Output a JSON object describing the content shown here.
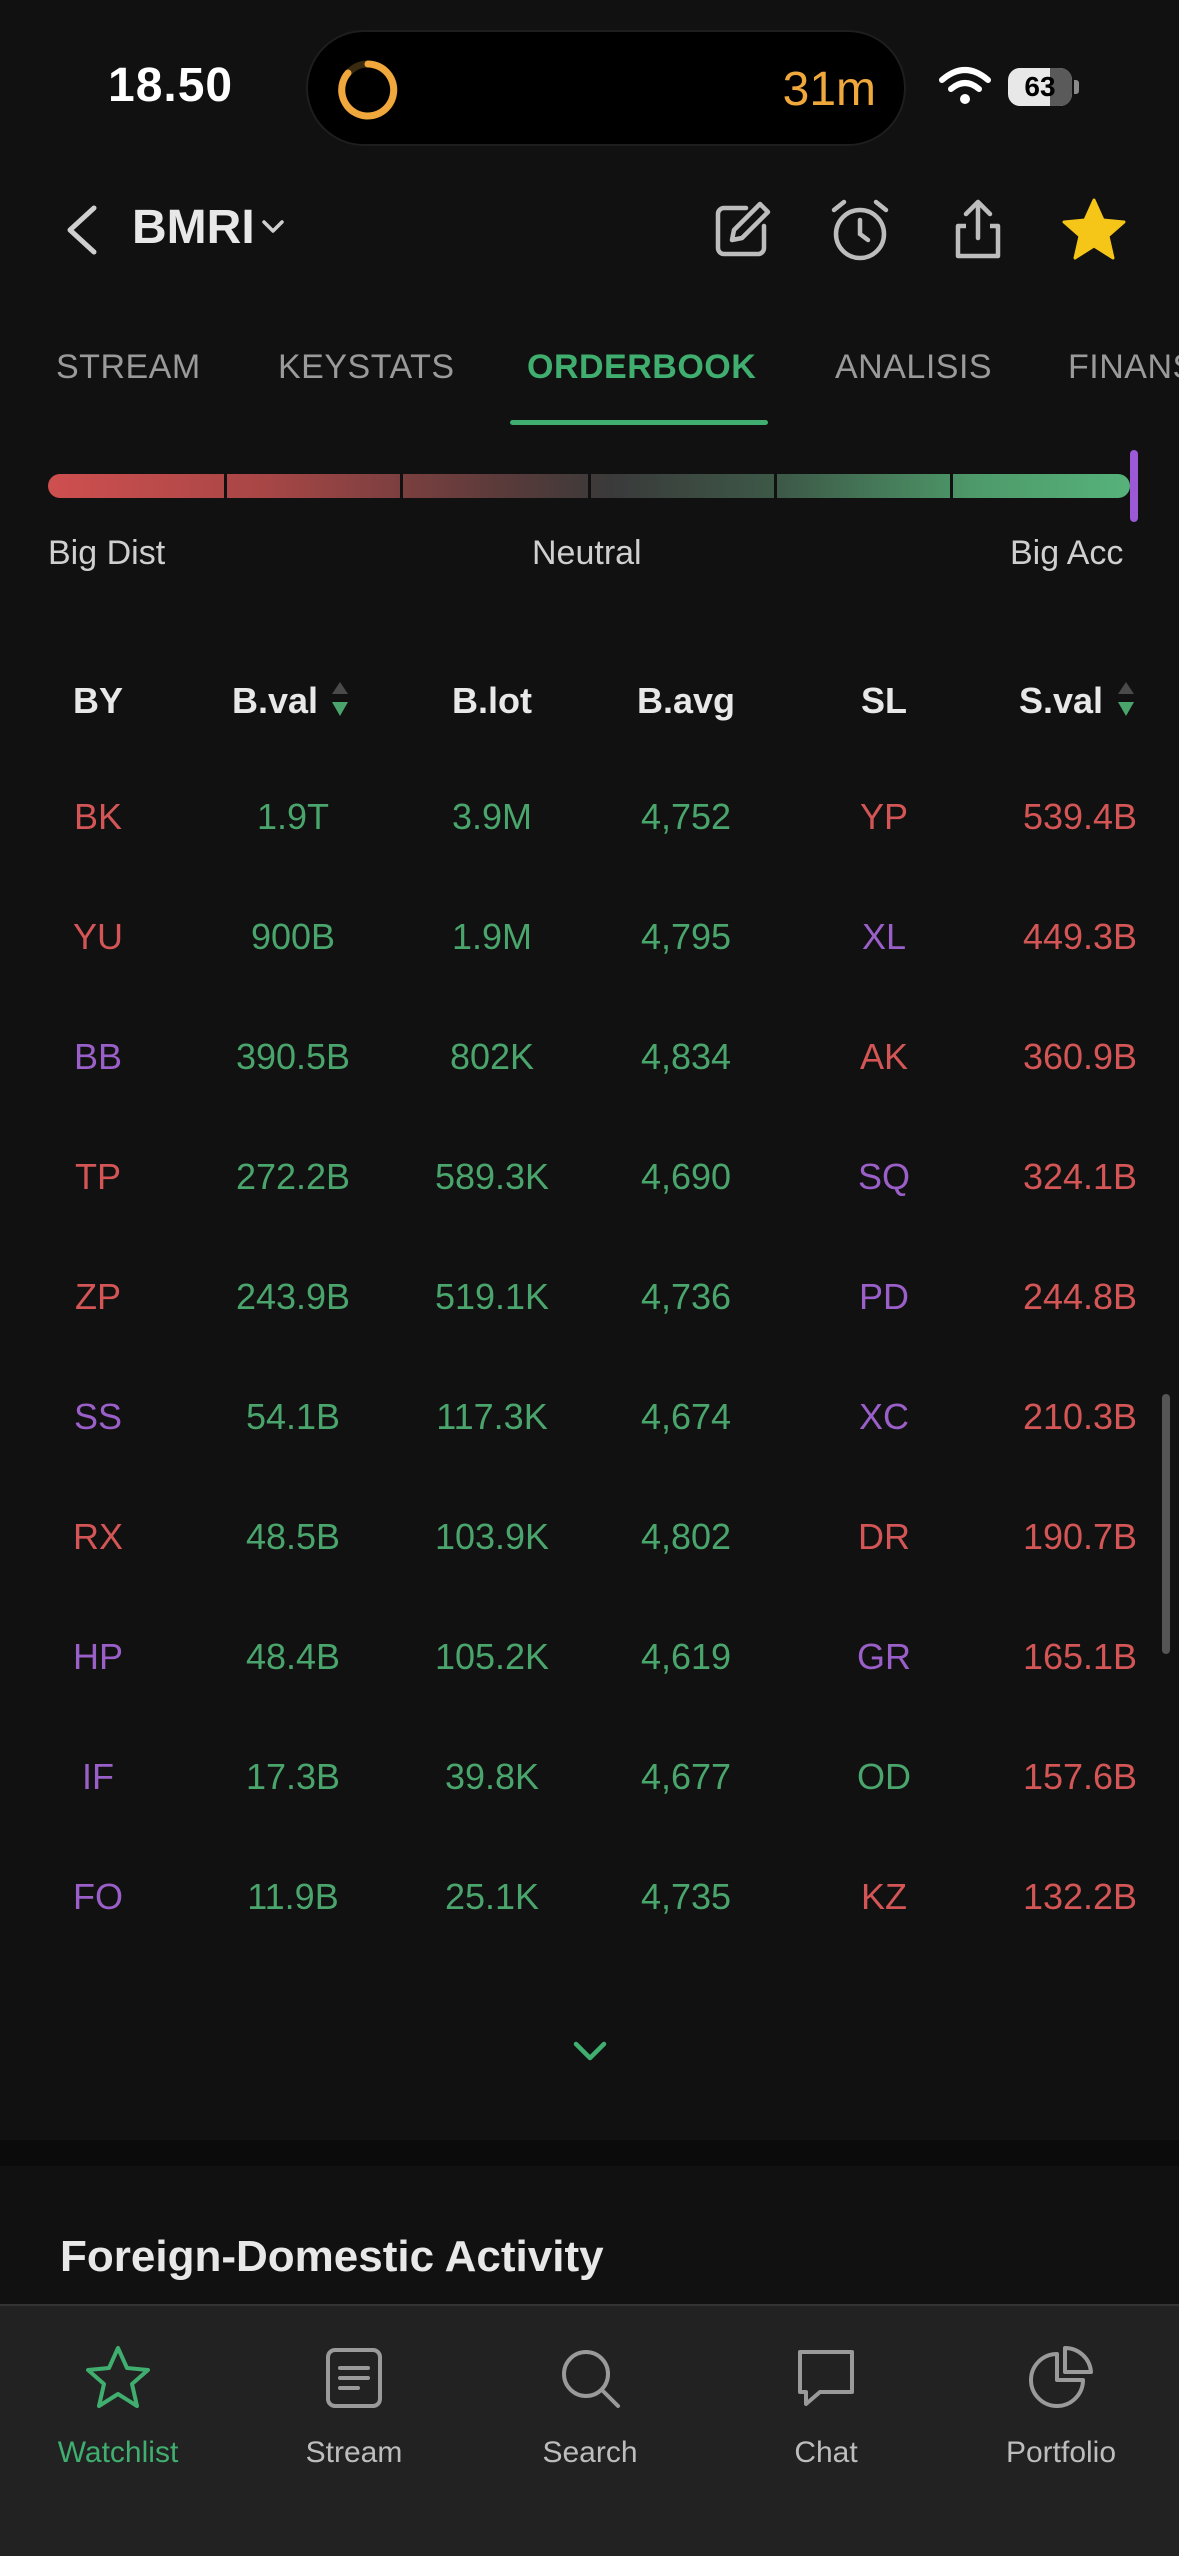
{
  "status_bar": {
    "time": "18.50",
    "activity_timer": "31m",
    "battery": "63",
    "accent_color": "#f0a83c"
  },
  "header": {
    "ticker": "BMRI",
    "icons": [
      "back-icon",
      "chevron-down-icon",
      "edit-icon",
      "alarm-icon",
      "share-icon",
      "star-icon"
    ]
  },
  "tabs": [
    {
      "label": "STREAM",
      "active": false
    },
    {
      "label": "KEYSTATS",
      "active": false
    },
    {
      "label": "ORDERBOOK",
      "active": true
    },
    {
      "label": "ANALISIS",
      "active": false
    },
    {
      "label": "FINANS",
      "active": false
    }
  ],
  "gauge": {
    "left_label": "Big Dist",
    "center_label": "Neutral",
    "right_label": "Big Acc",
    "value": 1.0,
    "marker_color": "#9b59d6"
  },
  "table": {
    "headers": {
      "by": "BY",
      "bval": "B.val",
      "blot": "B.lot",
      "bavg": "B.avg",
      "sl": "SL",
      "sval": "S.val"
    },
    "rows": [
      {
        "by": "BK",
        "by_color": "red",
        "bval": "1.9T",
        "blot": "3.9M",
        "bavg": "4,752",
        "sl": "YP",
        "sl_color": "red",
        "sval": "539.4B"
      },
      {
        "by": "YU",
        "by_color": "red",
        "bval": "900B",
        "blot": "1.9M",
        "bavg": "4,795",
        "sl": "XL",
        "sl_color": "purple",
        "sval": "449.3B"
      },
      {
        "by": "BB",
        "by_color": "purple",
        "bval": "390.5B",
        "blot": "802K",
        "bavg": "4,834",
        "sl": "AK",
        "sl_color": "red",
        "sval": "360.9B"
      },
      {
        "by": "TP",
        "by_color": "red",
        "bval": "272.2B",
        "blot": "589.3K",
        "bavg": "4,690",
        "sl": "SQ",
        "sl_color": "purple",
        "sval": "324.1B"
      },
      {
        "by": "ZP",
        "by_color": "red",
        "bval": "243.9B",
        "blot": "519.1K",
        "bavg": "4,736",
        "sl": "PD",
        "sl_color": "purple",
        "sval": "244.8B"
      },
      {
        "by": "SS",
        "by_color": "purple",
        "bval": "54.1B",
        "blot": "117.3K",
        "bavg": "4,674",
        "sl": "XC",
        "sl_color": "purple",
        "sval": "210.3B"
      },
      {
        "by": "RX",
        "by_color": "red",
        "bval": "48.5B",
        "blot": "103.9K",
        "bavg": "4,802",
        "sl": "DR",
        "sl_color": "red",
        "sval": "190.7B"
      },
      {
        "by": "HP",
        "by_color": "purple",
        "bval": "48.4B",
        "blot": "105.2K",
        "bavg": "4,619",
        "sl": "GR",
        "sl_color": "purple",
        "sval": "165.1B"
      },
      {
        "by": "IF",
        "by_color": "purple",
        "bval": "17.3B",
        "blot": "39.8K",
        "bavg": "4,677",
        "sl": "OD",
        "sl_color": "green",
        "sval": "157.6B"
      },
      {
        "by": "FO",
        "by_color": "purple",
        "bval": "11.9B",
        "blot": "25.1K",
        "bavg": "4,735",
        "sl": "KZ",
        "sl_color": "red",
        "sval": "132.2B"
      }
    ]
  },
  "section": {
    "title": "Foreign-Domestic Activity"
  },
  "bottom_nav": [
    {
      "label": "Watchlist",
      "icon": "star-outline-icon",
      "active": true
    },
    {
      "label": "Stream",
      "icon": "stream-icon",
      "active": false
    },
    {
      "label": "Search",
      "icon": "search-icon",
      "active": false
    },
    {
      "label": "Chat",
      "icon": "chat-icon",
      "active": false
    },
    {
      "label": "Portfolio",
      "icon": "pie-chart-icon",
      "active": false
    }
  ],
  "colors": {
    "positive": "#4aa56c",
    "negative": "#d45555",
    "foreign": "#9b5fc9",
    "accent": "#3fae6f",
    "background": "#111111"
  }
}
